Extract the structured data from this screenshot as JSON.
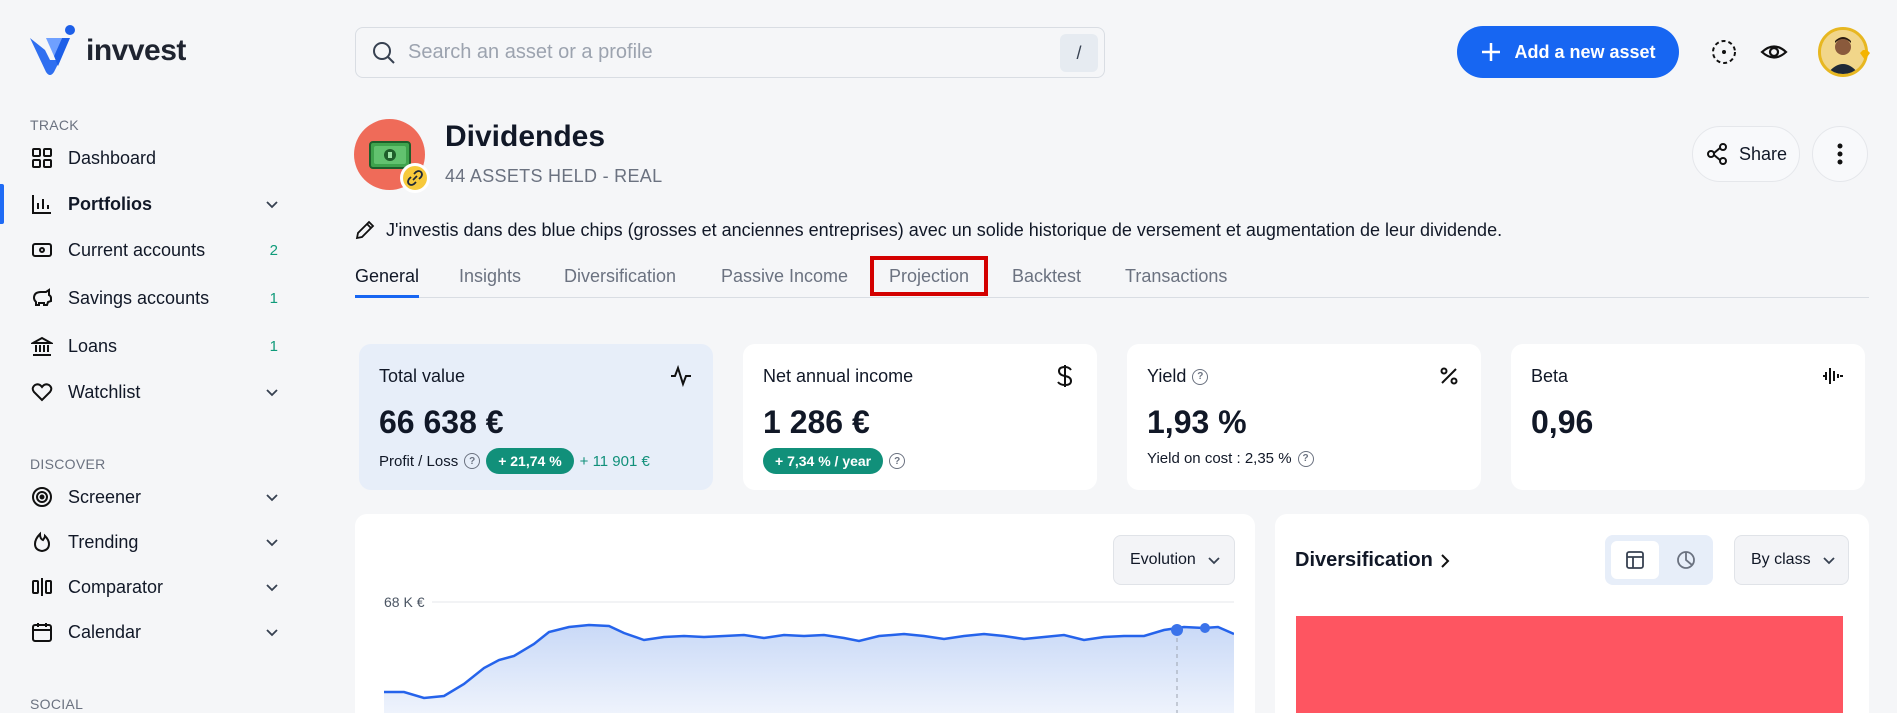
{
  "app": {
    "name": "invvest"
  },
  "sidebar": {
    "sections": [
      {
        "label": "TRACK"
      },
      {
        "label": "DISCOVER"
      },
      {
        "label": "SOCIAL"
      }
    ],
    "items": [
      {
        "label": "Dashboard",
        "icon": "grid-icon"
      },
      {
        "label": "Portfolios",
        "icon": "bar-chart-icon",
        "active": true
      },
      {
        "label": "Current accounts",
        "icon": "wallet-icon",
        "count": "2"
      },
      {
        "label": "Savings accounts",
        "icon": "piggy-bank-icon",
        "count": "1"
      },
      {
        "label": "Loans",
        "icon": "bank-icon",
        "count": "1"
      },
      {
        "label": "Watchlist",
        "icon": "heart-icon"
      },
      {
        "label": "Screener",
        "icon": "target-icon"
      },
      {
        "label": "Trending",
        "icon": "flame-icon"
      },
      {
        "label": "Comparator",
        "icon": "compare-icon"
      },
      {
        "label": "Calendar",
        "icon": "calendar-icon"
      }
    ]
  },
  "search": {
    "placeholder": "Search an asset or a profile",
    "shortcut": "/"
  },
  "header": {
    "add_button": "Add a new asset"
  },
  "portfolio": {
    "title": "Dividendes",
    "subtitle": "44 ASSETS HELD - REAL",
    "description": "J'investis dans des blue chips (grosses et anciennes entreprises) avec un solide historique de versement et augmentation de leur dividende.",
    "share_label": "Share"
  },
  "tabs": [
    {
      "label": "General",
      "active": true
    },
    {
      "label": "Insights"
    },
    {
      "label": "Diversification"
    },
    {
      "label": "Passive Income"
    },
    {
      "label": "Projection",
      "highlighted": true
    },
    {
      "label": "Backtest"
    },
    {
      "label": "Transactions"
    }
  ],
  "cards": {
    "total_value": {
      "title": "Total value",
      "value": "66 638 €",
      "pl_label": "Profit / Loss",
      "pl_percent": "+ 21,74 %",
      "pl_amount": "+ 11 901 €"
    },
    "net_income": {
      "title": "Net annual income",
      "value": "1 286 €",
      "growth": "+ 7,34 % / year"
    },
    "yield": {
      "title": "Yield",
      "value": "1,93 %",
      "yoc": "Yield on cost : 2,35 %"
    },
    "beta": {
      "title": "Beta",
      "value": "0,96"
    }
  },
  "chart_panel": {
    "dropdown": "Evolution",
    "y_tick": "68 K €"
  },
  "diversification": {
    "title": "Diversification",
    "dropdown": "By class"
  },
  "colors": {
    "accent": "#1766f2",
    "positive": "#11907a",
    "highlight": "#d30000",
    "diversification_bar": "#fe5561"
  }
}
